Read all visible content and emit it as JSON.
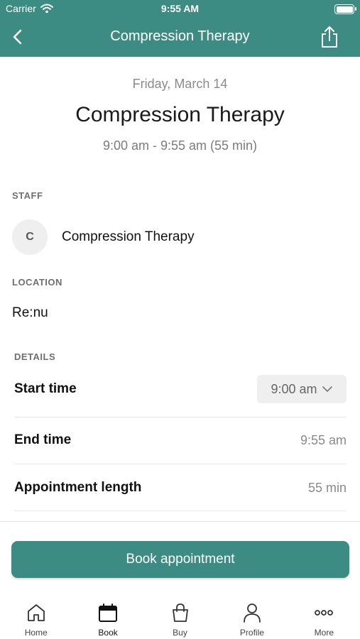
{
  "status_bar": {
    "carrier": "Carrier",
    "time": "9:55 AM"
  },
  "nav": {
    "title": "Compression Therapy"
  },
  "header": {
    "date": "Friday, March 14",
    "service": "Compression Therapy",
    "time_range": "9:00 am - 9:55 am (55 min)"
  },
  "staff": {
    "label": "STAFF",
    "initial": "C",
    "name": "Compression Therapy"
  },
  "location": {
    "label": "LOCATION",
    "value": "Re:nu"
  },
  "details": {
    "label": "DETAILS",
    "start_time_label": "Start time",
    "start_time_value": "9:00 am",
    "end_time_label": "End time",
    "end_time_value": "9:55 am",
    "length_label": "Appointment length",
    "length_value": "55 min"
  },
  "book_button": "Book appointment",
  "tabs": [
    {
      "label": "Home",
      "icon": "home-icon"
    },
    {
      "label": "Book",
      "icon": "calendar-icon",
      "active": true
    },
    {
      "label": "Buy",
      "icon": "shopping-bag-icon"
    },
    {
      "label": "Profile",
      "icon": "person-icon"
    },
    {
      "label": "More",
      "icon": "more-dots-icon"
    }
  ],
  "colors": {
    "brand": "#3d8c84",
    "muted": "#8a8a8a",
    "chip": "#efefef"
  }
}
